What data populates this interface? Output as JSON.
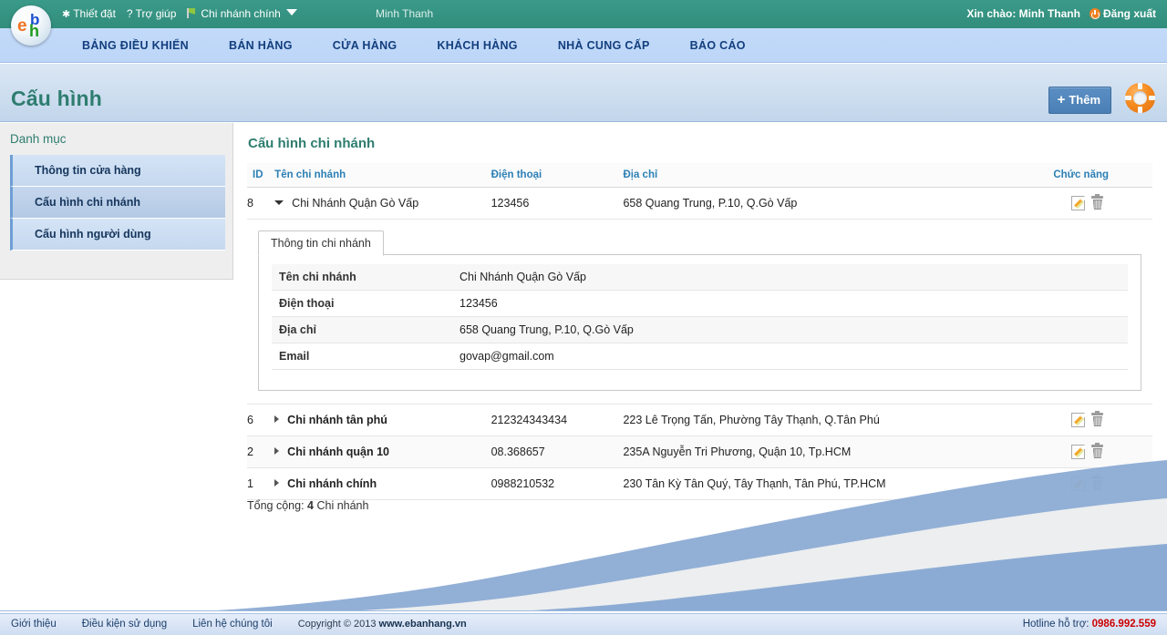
{
  "topbar": {
    "settings_label": "Thiết đặt",
    "help_label": "Trợ giúp",
    "branch_label": "Chi nhánh chính",
    "username": "Minh Thanh",
    "greeting": "Xin chào: Minh Thanh",
    "logout_label": "Đăng xuất"
  },
  "logo": {
    "e": "e",
    "b": "b",
    "h": "h"
  },
  "nav": {
    "items": [
      {
        "label": "BẢNG ĐIỀU KHIỂN"
      },
      {
        "label": "BÁN HÀNG"
      },
      {
        "label": "CỬA HÀNG"
      },
      {
        "label": "KHÁCH HÀNG"
      },
      {
        "label": "NHÀ CUNG CẤP"
      },
      {
        "label": "BÁO CÁO"
      }
    ]
  },
  "page": {
    "title": "Cấu hình",
    "add_button": "Thêm",
    "add_plus": "+"
  },
  "sidebar": {
    "title": "Danh mục",
    "items": [
      {
        "label": "Thông tin cửa hàng"
      },
      {
        "label": "Cấu hình chi nhánh"
      },
      {
        "label": "Cấu hình người dùng"
      }
    ]
  },
  "main": {
    "section_title": "Cấu hình chi nhánh",
    "columns": {
      "id": "ID",
      "name": "Tên chi nhánh",
      "phone": "Điện thoại",
      "address": "Địa chỉ",
      "actions": "Chức năng"
    },
    "rows": [
      {
        "id": "8",
        "name": "Chi Nhánh Quận Gò Vấp",
        "phone": "123456",
        "address": "658 Quang Trung, P.10, Q.Gò Vấp",
        "expanded": true
      },
      {
        "id": "6",
        "name": "Chi nhánh tân phú",
        "phone": "212324343434",
        "address": "223 Lê Trọng Tấn, Phường Tây Thạnh, Q.Tân Phú",
        "expanded": false
      },
      {
        "id": "2",
        "name": "Chi nhánh quận 10",
        "phone": "08.368657",
        "address": "235A Nguyễn Tri Phương, Quận 10, Tp.HCM",
        "expanded": false
      },
      {
        "id": "1",
        "name": "Chi nhánh chính",
        "phone": "0988210532",
        "address": "230 Tân Kỳ Tân Quý, Tây Thạnh, Tân Phú, TP.HCM",
        "expanded": false
      }
    ],
    "detail": {
      "tab_label": "Thông tin chi nhánh",
      "fields": [
        {
          "key": "Tên chi nhánh",
          "value": "Chi Nhánh Quận Gò Vấp"
        },
        {
          "key": "Điện thoại",
          "value": "123456"
        },
        {
          "key": "Địa chỉ",
          "value": "658 Quang Trung, P.10, Q.Gò Vấp"
        },
        {
          "key": "Email",
          "value": "govap@gmail.com"
        }
      ]
    },
    "total_prefix": "Tổng cộng:",
    "total_count": "4",
    "total_suffix": "Chi nhánh"
  },
  "footer": {
    "links": [
      {
        "label": "Giới thiệu"
      },
      {
        "label": "Điều kiện sử dụng"
      },
      {
        "label": "Liên hệ chúng tôi"
      }
    ],
    "copyright": "Copyright © 2013",
    "site": "www.ebanhang.vn",
    "hotline_label": "Hotline hỗ trợ:",
    "hotline_number": "0986.992.559"
  },
  "colors": {
    "teal": "#349081",
    "nav_blue": "#c3daf9",
    "title_green": "#2e7d6f",
    "link_blue": "#2b7fb5",
    "hotline_red": "#cc0000",
    "swoosh_blue": "#8cabd4",
    "swoosh_gray": "#e9eced"
  }
}
